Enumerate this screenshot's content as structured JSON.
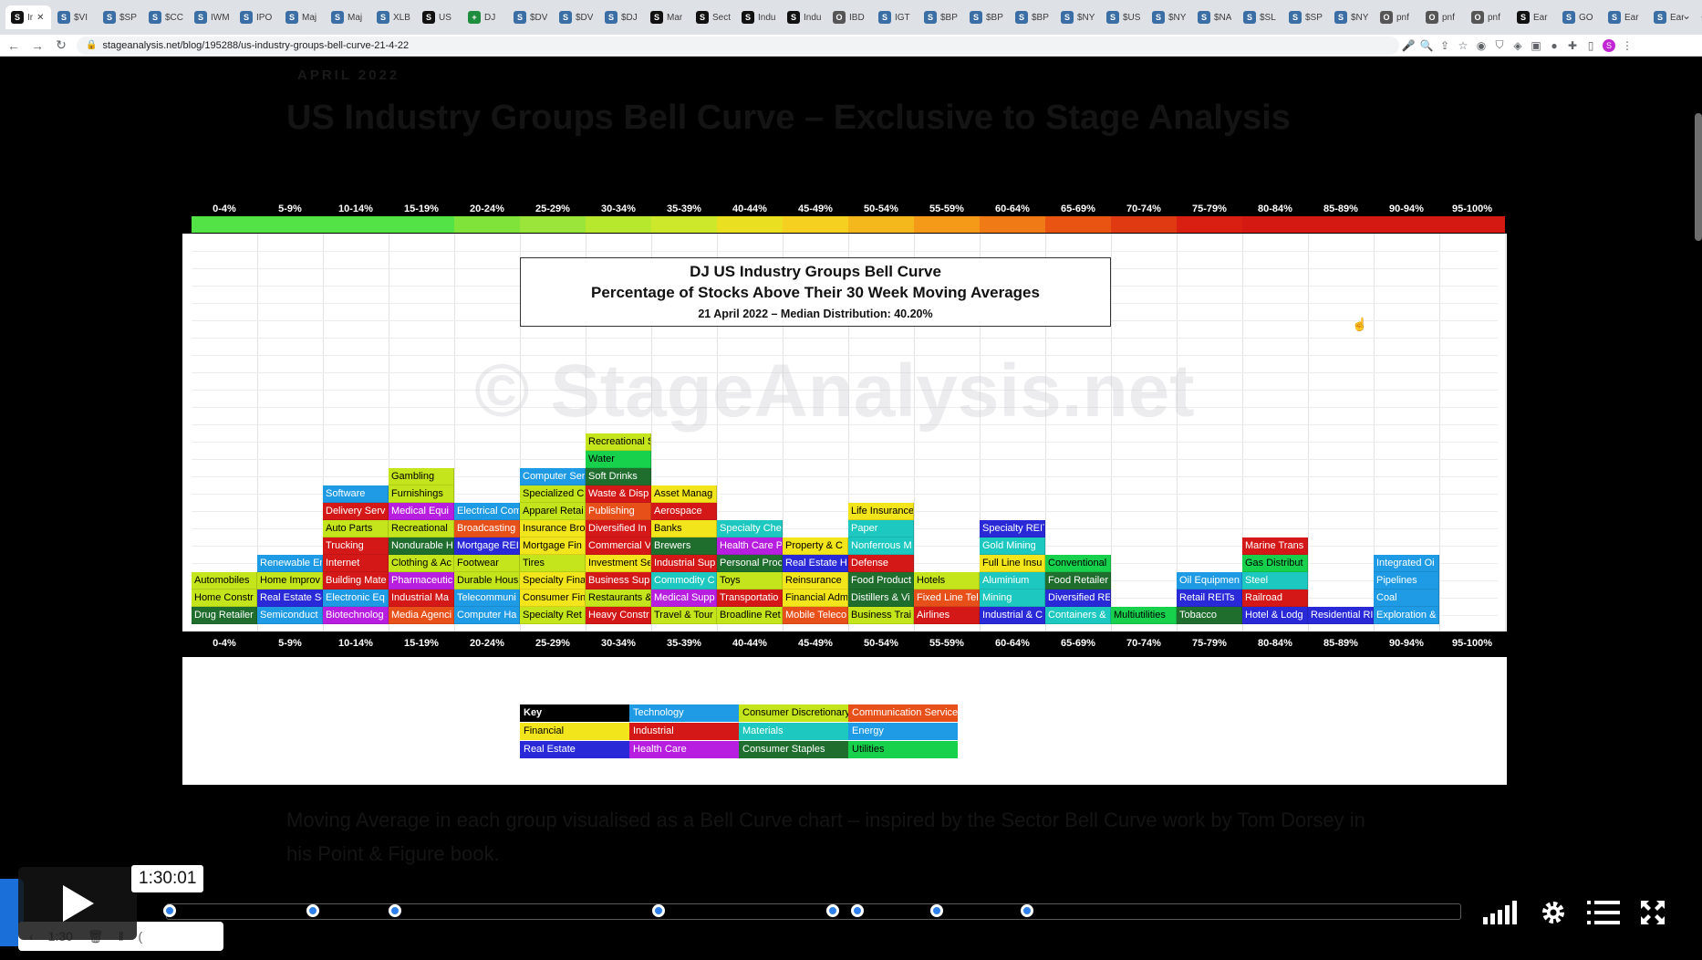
{
  "browser": {
    "tabs": [
      {
        "label": "Ir",
        "favicon": "S",
        "color": "#111111",
        "active": true
      },
      {
        "label": "$VI",
        "favicon": "S",
        "color": "#3a6ea5"
      },
      {
        "label": "$SP",
        "favicon": "S",
        "color": "#3a6ea5"
      },
      {
        "label": "$CC",
        "favicon": "S",
        "color": "#3a6ea5"
      },
      {
        "label": "IWM",
        "favicon": "S",
        "color": "#3a6ea5"
      },
      {
        "label": "IPO",
        "favicon": "S",
        "color": "#3a6ea5"
      },
      {
        "label": "Maj",
        "favicon": "S",
        "color": "#3a6ea5"
      },
      {
        "label": "Maj",
        "favicon": "S",
        "color": "#3a6ea5"
      },
      {
        "label": "XLB",
        "favicon": "S",
        "color": "#3a6ea5"
      },
      {
        "label": "US",
        "favicon": "S",
        "color": "#111111"
      },
      {
        "label": "DJ",
        "favicon": "+",
        "color": "#1e8e3e"
      },
      {
        "label": "$DV",
        "favicon": "S",
        "color": "#3a6ea5"
      },
      {
        "label": "$DV",
        "favicon": "S",
        "color": "#3a6ea5"
      },
      {
        "label": "$DJ",
        "favicon": "S",
        "color": "#3a6ea5"
      },
      {
        "label": "Mar",
        "favicon": "S",
        "color": "#111111"
      },
      {
        "label": "Sect",
        "favicon": "S",
        "color": "#111111"
      },
      {
        "label": "Indu",
        "favicon": "S",
        "color": "#111111"
      },
      {
        "label": "Indu",
        "favicon": "S",
        "color": "#111111"
      },
      {
        "label": "IBD",
        "favicon": "O",
        "color": "#555555"
      },
      {
        "label": "IGT",
        "favicon": "S",
        "color": "#3a6ea5"
      },
      {
        "label": "$BP",
        "favicon": "S",
        "color": "#3a6ea5"
      },
      {
        "label": "$BP",
        "favicon": "S",
        "color": "#3a6ea5"
      },
      {
        "label": "$BP",
        "favicon": "S",
        "color": "#3a6ea5"
      },
      {
        "label": "$NY",
        "favicon": "S",
        "color": "#3a6ea5"
      },
      {
        "label": "$US",
        "favicon": "S",
        "color": "#3a6ea5"
      },
      {
        "label": "$NY",
        "favicon": "S",
        "color": "#3a6ea5"
      },
      {
        "label": "$NA",
        "favicon": "S",
        "color": "#3a6ea5"
      },
      {
        "label": "$SL",
        "favicon": "S",
        "color": "#3a6ea5"
      },
      {
        "label": "$SP",
        "favicon": "S",
        "color": "#3a6ea5"
      },
      {
        "label": "$NY",
        "favicon": "S",
        "color": "#3a6ea5"
      },
      {
        "label": "pnf",
        "favicon": "O",
        "color": "#555555"
      },
      {
        "label": "pnf",
        "favicon": "O",
        "color": "#555555"
      },
      {
        "label": "pnf",
        "favicon": "O",
        "color": "#555555"
      },
      {
        "label": "Ear",
        "favicon": "S",
        "color": "#111111"
      },
      {
        "label": "GO",
        "favicon": "S",
        "color": "#3a6ea5"
      },
      {
        "label": "Ear",
        "favicon": "S",
        "color": "#3a6ea5"
      },
      {
        "label": "Ear",
        "favicon": "S",
        "color": "#3a6ea5"
      }
    ],
    "new_tab": "+",
    "tab_menu": "⌄",
    "url": "stageanalysis.net/blog/195288/us-industry-groups-bell-curve-21-4-22"
  },
  "post": {
    "date": "APRIL 2022",
    "title": "US Industry Groups Bell Curve – Exclusive to Stage Analysis",
    "body": "Moving Average in each group visualised as a Bell Curve chart – inspired by the Sector Bell Curve work by Tom Dorsey in his Point & Figure book."
  },
  "chart": {
    "title_line1": "DJ US Industry Groups Bell Curve",
    "title_line2": "Percentage of Stocks Above Their 30 Week Moving Averages",
    "title_line3": "21 April 2022 – Median Distribution: 40.20%",
    "watermark": "© StageAnalysis.net",
    "buckets": [
      "0-4%",
      "5-9%",
      "10-14%",
      "15-19%",
      "20-24%",
      "25-29%",
      "30-34%",
      "35-39%",
      "40-44%",
      "45-49%",
      "50-54%",
      "55-59%",
      "60-64%",
      "65-69%",
      "70-74%",
      "75-79%",
      "80-84%",
      "85-89%",
      "90-94%",
      "95-100%"
    ],
    "heat_colors": [
      "#54e346",
      "#54e346",
      "#54e346",
      "#54e346",
      "#7fe33a",
      "#9be53a",
      "#b7e82e",
      "#cde82a",
      "#eadf20",
      "#f5d020",
      "#f5b81c",
      "#f59a18",
      "#f07a15",
      "#ea5412",
      "#e03a12",
      "#d81f12",
      "#d41812",
      "#d41812",
      "#d41812",
      "#d41812"
    ],
    "columns": [
      [
        [
          "Automobiles",
          "#c4e51b",
          "#000"
        ],
        [
          "Home Constr",
          "#c4e51b",
          "#000"
        ],
        [
          "Drug Retailer",
          "#1f6e2e",
          "#fff"
        ]
      ],
      [
        [
          "Renewable Er",
          "#1e9be4",
          "#fff"
        ],
        [
          "Home Improv",
          "#c4e51b",
          "#000"
        ],
        [
          "Real Estate Se",
          "#2929d8",
          "#fff"
        ],
        [
          "Semiconduct",
          "#1e9be4",
          "#fff"
        ]
      ],
      [
        [
          "Software",
          "#1e9be4",
          "#fff"
        ],
        [
          "Delivery Serv",
          "#d41818",
          "#fff"
        ],
        [
          "Auto Parts",
          "#c4e51b",
          "#000"
        ],
        [
          "Trucking",
          "#d41818",
          "#fff"
        ],
        [
          "Internet",
          "#d41818",
          "#fff"
        ],
        [
          "Building Mate",
          "#d41818",
          "#fff"
        ],
        [
          "Electronic Eq",
          "#1e9be4",
          "#fff"
        ],
        [
          "Biotechnolog",
          "#b81ee0",
          "#fff"
        ]
      ],
      [
        [
          "Gambling",
          "#c4e51b",
          "#000"
        ],
        [
          "Furnishings",
          "#c4e51b",
          "#000"
        ],
        [
          "Medical Equi",
          "#b81ee0",
          "#fff"
        ],
        [
          "Recreational",
          "#c4e51b",
          "#000"
        ],
        [
          "Nondurable H",
          "#1f6e2e",
          "#fff"
        ],
        [
          "Clothing & Ac",
          "#c4e51b",
          "#000"
        ],
        [
          "Pharmaceutic",
          "#b81ee0",
          "#fff"
        ],
        [
          "Industrial Ma",
          "#d41818",
          "#fff"
        ],
        [
          "Media Agenci",
          "#e8501a",
          "#fff"
        ]
      ],
      [
        [
          "Electrical Com",
          "#1e9be4",
          "#fff"
        ],
        [
          "Broadcasting",
          "#e8501a",
          "#fff"
        ],
        [
          "Mortgage REI",
          "#2929d8",
          "#fff"
        ],
        [
          "Footwear",
          "#c4e51b",
          "#000"
        ],
        [
          "Durable Hous",
          "#c4e51b",
          "#000"
        ],
        [
          "Telecommuni",
          "#1e9be4",
          "#fff"
        ],
        [
          "Computer Ha",
          "#1e9be4",
          "#fff"
        ]
      ],
      [
        [
          "Computer Ser",
          "#1e9be4",
          "#fff"
        ],
        [
          "Specialized C",
          "#c4e51b",
          "#000"
        ],
        [
          "Apparel Retai",
          "#c4e51b",
          "#000"
        ],
        [
          "Insurance Bro",
          "#f2e51c",
          "#000"
        ],
        [
          "Mortgage Fin",
          "#f2e51c",
          "#000"
        ],
        [
          "Tires",
          "#c4e51b",
          "#000"
        ],
        [
          "Specialty Fina",
          "#f2e51c",
          "#000"
        ],
        [
          "Consumer Fin",
          "#f2e51c",
          "#000"
        ],
        [
          "Specialty Ret",
          "#c4e51b",
          "#000"
        ]
      ],
      [
        [
          "Recreational S",
          "#c4e51b",
          "#000"
        ],
        [
          "Water",
          "#17d14c",
          "#000"
        ],
        [
          "Soft Drinks",
          "#1f6e2e",
          "#fff"
        ],
        [
          "Waste & Disp",
          "#d41818",
          "#fff"
        ],
        [
          "Publishing",
          "#e8501a",
          "#fff"
        ],
        [
          "Diversified In",
          "#d41818",
          "#fff"
        ],
        [
          "Commercial V",
          "#d41818",
          "#fff"
        ],
        [
          "Investment Se",
          "#f2e51c",
          "#000"
        ],
        [
          "Business Sup",
          "#d41818",
          "#fff"
        ],
        [
          "Restaurants &",
          "#c4e51b",
          "#000"
        ],
        [
          "Heavy Constr",
          "#d41818",
          "#fff"
        ]
      ],
      [
        [
          "Asset Manag",
          "#f2e51c",
          "#000"
        ],
        [
          "Aerospace",
          "#d41818",
          "#fff"
        ],
        [
          "Banks",
          "#f2e51c",
          "#000"
        ],
        [
          "Brewers",
          "#1f6e2e",
          "#fff"
        ],
        [
          "Industrial Sup",
          "#d41818",
          "#fff"
        ],
        [
          "Commodity C",
          "#1dc8c0",
          "#fff"
        ],
        [
          "Medical Supp",
          "#b81ee0",
          "#fff"
        ],
        [
          "Travel & Tour",
          "#c4e51b",
          "#000"
        ]
      ],
      [
        [
          "Specialty Che",
          "#1dc8c0",
          "#fff"
        ],
        [
          "Health Care P",
          "#b81ee0",
          "#fff"
        ],
        [
          "Personal Proc",
          "#1f6e2e",
          "#fff"
        ],
        [
          "Toys",
          "#c4e51b",
          "#000"
        ],
        [
          "Transportatio",
          "#d41818",
          "#fff"
        ],
        [
          "Broadline Ret",
          "#c4e51b",
          "#000"
        ]
      ],
      [
        [
          "Property & C",
          "#f2e51c",
          "#000"
        ],
        [
          "Real Estate H",
          "#2929d8",
          "#fff"
        ],
        [
          "Reinsurance",
          "#f2e51c",
          "#000"
        ],
        [
          "Financial Adm",
          "#f2e51c",
          "#000"
        ],
        [
          "Mobile Teleco",
          "#e8501a",
          "#fff"
        ]
      ],
      [
        [
          "Life Insurance",
          "#f2e51c",
          "#000"
        ],
        [
          "Paper",
          "#1dc8c0",
          "#fff"
        ],
        [
          "Nonferrous M",
          "#1dc8c0",
          "#fff"
        ],
        [
          "Defense",
          "#d41818",
          "#fff"
        ],
        [
          "Food Product",
          "#1f6e2e",
          "#fff"
        ],
        [
          "Distillers & Vi",
          "#1f6e2e",
          "#fff"
        ],
        [
          "Business Trai",
          "#c4e51b",
          "#000"
        ]
      ],
      [
        [
          "Hotels",
          "#c4e51b",
          "#000"
        ],
        [
          "Fixed Line Tel",
          "#e8501a",
          "#fff"
        ],
        [
          "Airlines",
          "#d41818",
          "#fff"
        ]
      ],
      [
        [
          "Specialty REIT",
          "#2929d8",
          "#fff"
        ],
        [
          "Gold Mining",
          "#1dc8c0",
          "#fff"
        ],
        [
          "Full Line Insu",
          "#f2e51c",
          "#000"
        ],
        [
          "Aluminium",
          "#1dc8c0",
          "#fff"
        ],
        [
          "Mining",
          "#1dc8c0",
          "#fff"
        ],
        [
          "Industrial & C",
          "#2929d8",
          "#fff"
        ]
      ],
      [
        [
          "Conventional",
          "#17d14c",
          "#000"
        ],
        [
          "Food Retailer",
          "#1f6e2e",
          "#fff"
        ],
        [
          "Diversified RE",
          "#2929d8",
          "#fff"
        ],
        [
          "Containers &",
          "#1dc8c0",
          "#fff"
        ]
      ],
      [
        [
          "Multiutilities",
          "#17d14c",
          "#000"
        ]
      ],
      [
        [
          "Oil Equipmen",
          "#1e9be4",
          "#fff"
        ],
        [
          "Retail REITs",
          "#2929d8",
          "#fff"
        ],
        [
          "Tobacco",
          "#1f6e2e",
          "#fff"
        ]
      ],
      [
        [
          "Marine Trans",
          "#d41818",
          "#fff"
        ],
        [
          "Gas Distribut",
          "#17d14c",
          "#000"
        ],
        [
          "Steel",
          "#1dc8c0",
          "#fff"
        ],
        [
          "Railroad",
          "#d41818",
          "#fff"
        ],
        [
          "Hotel & Lodg",
          "#2929d8",
          "#fff"
        ]
      ],
      [
        [
          "Residential RI",
          "#2929d8",
          "#fff"
        ]
      ],
      [
        [
          "Integrated Oi",
          "#1e9be4",
          "#fff"
        ],
        [
          "Pipelines",
          "#1e9be4",
          "#fff"
        ],
        [
          "Coal",
          "#1e9be4",
          "#fff"
        ],
        [
          "Exploration &",
          "#1e9be4",
          "#fff"
        ]
      ],
      []
    ],
    "legend": [
      [
        "Key",
        "#000000",
        "#ffffff"
      ],
      [
        "Technology",
        "#1e9be4",
        "#ffffff"
      ],
      [
        "Consumer Discretionary",
        "#c4e51b",
        "#000000"
      ],
      [
        "Communication Services",
        "#e8501a",
        "#ffffff"
      ],
      [
        "Financial",
        "#f2e51c",
        "#000000"
      ],
      [
        "Industrial",
        "#d41818",
        "#ffffff"
      ],
      [
        "Materials",
        "#1dc8c0",
        "#ffffff"
      ],
      [
        "Energy",
        "#1e9be4",
        "#ffffff"
      ],
      [
        "Real Estate",
        "#2929d8",
        "#ffffff"
      ],
      [
        "Health Care",
        "#b81ee0",
        "#ffffff"
      ],
      [
        "Consumer Staples",
        "#1f6e2e",
        "#ffffff"
      ],
      [
        "Utilities",
        "#17d14c",
        "#000000"
      ]
    ]
  },
  "player": {
    "timecode": "1:30:01",
    "chapter_markers": [
      0.0,
      0.111,
      0.175,
      0.379,
      0.514,
      0.533,
      0.595,
      0.665
    ],
    "icons": [
      "play-icon",
      "volume-icon",
      "settings-icon",
      "chapters-icon",
      "fullscreen-icon"
    ],
    "ghost_controls": [
      "‹",
      "1:30",
      "🗑",
      "‖",
      "("
    ]
  },
  "colors": {
    "accent": "#2f80ed",
    "video_bg": "#000000"
  }
}
